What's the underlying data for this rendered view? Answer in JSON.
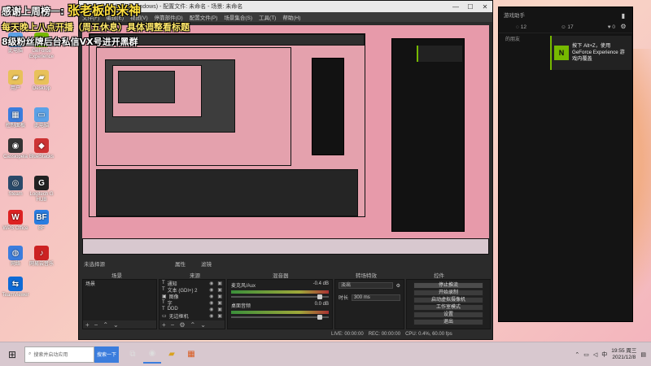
{
  "overlay": {
    "line1_prefix": "感谢上周榜一:",
    "line1_highlight": "张老板的米神",
    "line2": "每天晚上八点开播（周五休息）具体调整看标题",
    "line3": "8级粉丝牌后台私信VX号进开黑群"
  },
  "obs": {
    "title": "OBS 27.1.3 (64-bit, windows) - 配置文件: 未命名 - 场景: 未命名",
    "menu": [
      "文件(F)",
      "编辑(E)",
      "视图(V)",
      "停靠部件(D)",
      "配置文件(P)",
      "场景集合(S)",
      "工具(T)",
      "帮助(H)"
    ],
    "no_source": "未选择源",
    "props_button": "属性",
    "filters_button": "滤镜",
    "docks": {
      "scenes": "场景",
      "sources": "来源",
      "mixer": "混音器",
      "transitions": "转场特效",
      "controls": "控件"
    },
    "scene_items": [
      "场景"
    ],
    "sources": [
      {
        "icon": "T",
        "label": "通知"
      },
      {
        "icon": "T",
        "label": "文本 (GDI+) 2"
      },
      {
        "icon": "▣",
        "label": "图像"
      },
      {
        "icon": "T",
        "label": "字"
      },
      {
        "icon": "T",
        "label": "DDD"
      },
      {
        "icon": "▭",
        "label": "无边框机"
      }
    ],
    "mixer": [
      {
        "name": "麦克风/Aux",
        "db": "-0.4 dB"
      },
      {
        "name": "桌面音频",
        "db": "0.0 dB"
      }
    ],
    "transitions": {
      "type": "淡出",
      "duration_label": "时长",
      "duration_value": "300 ms"
    },
    "controls": [
      "停止推流",
      "开始录制",
      "启动虚拟摄像机",
      "工作室模式",
      "设置",
      "退出"
    ],
    "status": {
      "live": "LIVE: 00:00:00",
      "rec": "REC: 00:00:00",
      "cpu": "CPU: 0.4%, 60.00 fps"
    }
  },
  "geforce": {
    "panel_title": "游戏助手",
    "counts": [
      "12",
      "17",
      "0"
    ],
    "row_label": "的朋友",
    "toast_logo": "N",
    "toast_text": "按下 Alt+Z，使用 GeForce Experience 游戏内覆盖"
  },
  "desktop_icons": [
    {
      "label": "此电脑",
      "glyph": "▭",
      "color": "#5ba1e6"
    },
    {
      "label": "GeForce Experience",
      "glyph": "N",
      "color": "#76b900"
    },
    {
      "label": "用户",
      "glyph": "▰",
      "color": "#e8c15a"
    },
    {
      "label": "Desktop",
      "glyph": "▰",
      "color": "#e8c15a"
    },
    {
      "label": "控制面板",
      "glyph": "▦",
      "color": "#3b7ddd"
    },
    {
      "label": "此电脑",
      "glyph": "▭",
      "color": "#5ba1e6"
    },
    {
      "label": "Cassiopeia",
      "glyph": "◉",
      "color": "#333"
    },
    {
      "label": "BlueStacks",
      "glyph": "◆",
      "color": "#c33"
    },
    {
      "label": "Steam",
      "glyph": "◎",
      "color": "#2a4a6a"
    },
    {
      "label": "Logitech G HUB",
      "glyph": "G",
      "color": "#222"
    },
    {
      "label": "WPS Office",
      "glyph": "W",
      "color": "#d22"
    },
    {
      "label": "BF",
      "glyph": "BF",
      "color": "#2a7de1"
    },
    {
      "label": "网络",
      "glyph": "◍",
      "color": "#3b7ddd"
    },
    {
      "label": "网易云音乐",
      "glyph": "♪",
      "color": "#c22"
    },
    {
      "label": "TeamViewer",
      "glyph": "⇆",
      "color": "#0e6bd6"
    }
  ],
  "taskbar": {
    "search_placeholder": "搜索并启动应用",
    "search_button": "搜索一下",
    "time": "19:55 周三",
    "date": "2021/12/8"
  }
}
